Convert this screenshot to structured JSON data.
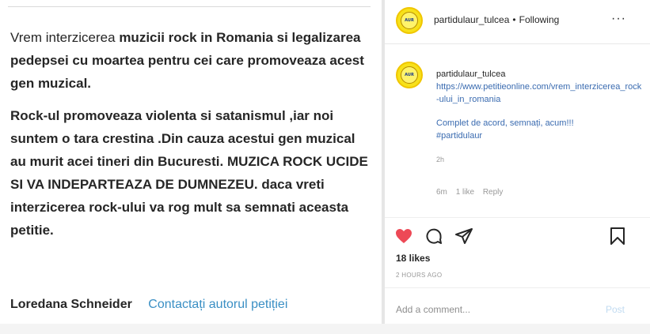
{
  "petition": {
    "p1_plain1": "Vrem interzicerea ",
    "p1_bold1": "muzicii rock in Romania si legalizarea pedepsei cu moartea pentru cei care promoveaza acest gen muzical.",
    "p2": "Rock-ul promoveaza violenta si satanismul ,iar noi suntem o tara crestina .Din cauza acestui gen muzical au murit acei tineri din Bucuresti. MUZICA ROCK UCIDE SI VA INDEPARTEAZA DE DUMNEZEU. daca vreti interzicerea rock-ului va rog mult sa semnati aceasta petitie.",
    "author": "Loredana Schneider",
    "contact_link": "Contactați autorul petiției"
  },
  "post": {
    "avatar_text": "AUR",
    "username": "partidulaur_tulcea",
    "separator": "•",
    "follow_status": "Following",
    "more": "···",
    "comment": {
      "username": "partidulaur_tulcea",
      "link": "https://www.petitieonline.com/vrem_interzicerea_rock-ului_in_romania",
      "message": "Complet de acord, semnați, acum!!!",
      "hashtag": "#partidulaur",
      "age": "2h",
      "time": "6m",
      "likes": "1 like",
      "reply": "Reply"
    },
    "likes": "18 likes",
    "posted_ago": "2 HOURS AGO",
    "add_comment_placeholder": "Add a comment...",
    "post_button": "Post",
    "colors": {
      "heart": "#ed4956",
      "link": "#3a6bb0",
      "avatar": "#f7e11a"
    },
    "icons": [
      "heart-icon",
      "comment-icon",
      "share-icon",
      "bookmark-icon"
    ]
  }
}
